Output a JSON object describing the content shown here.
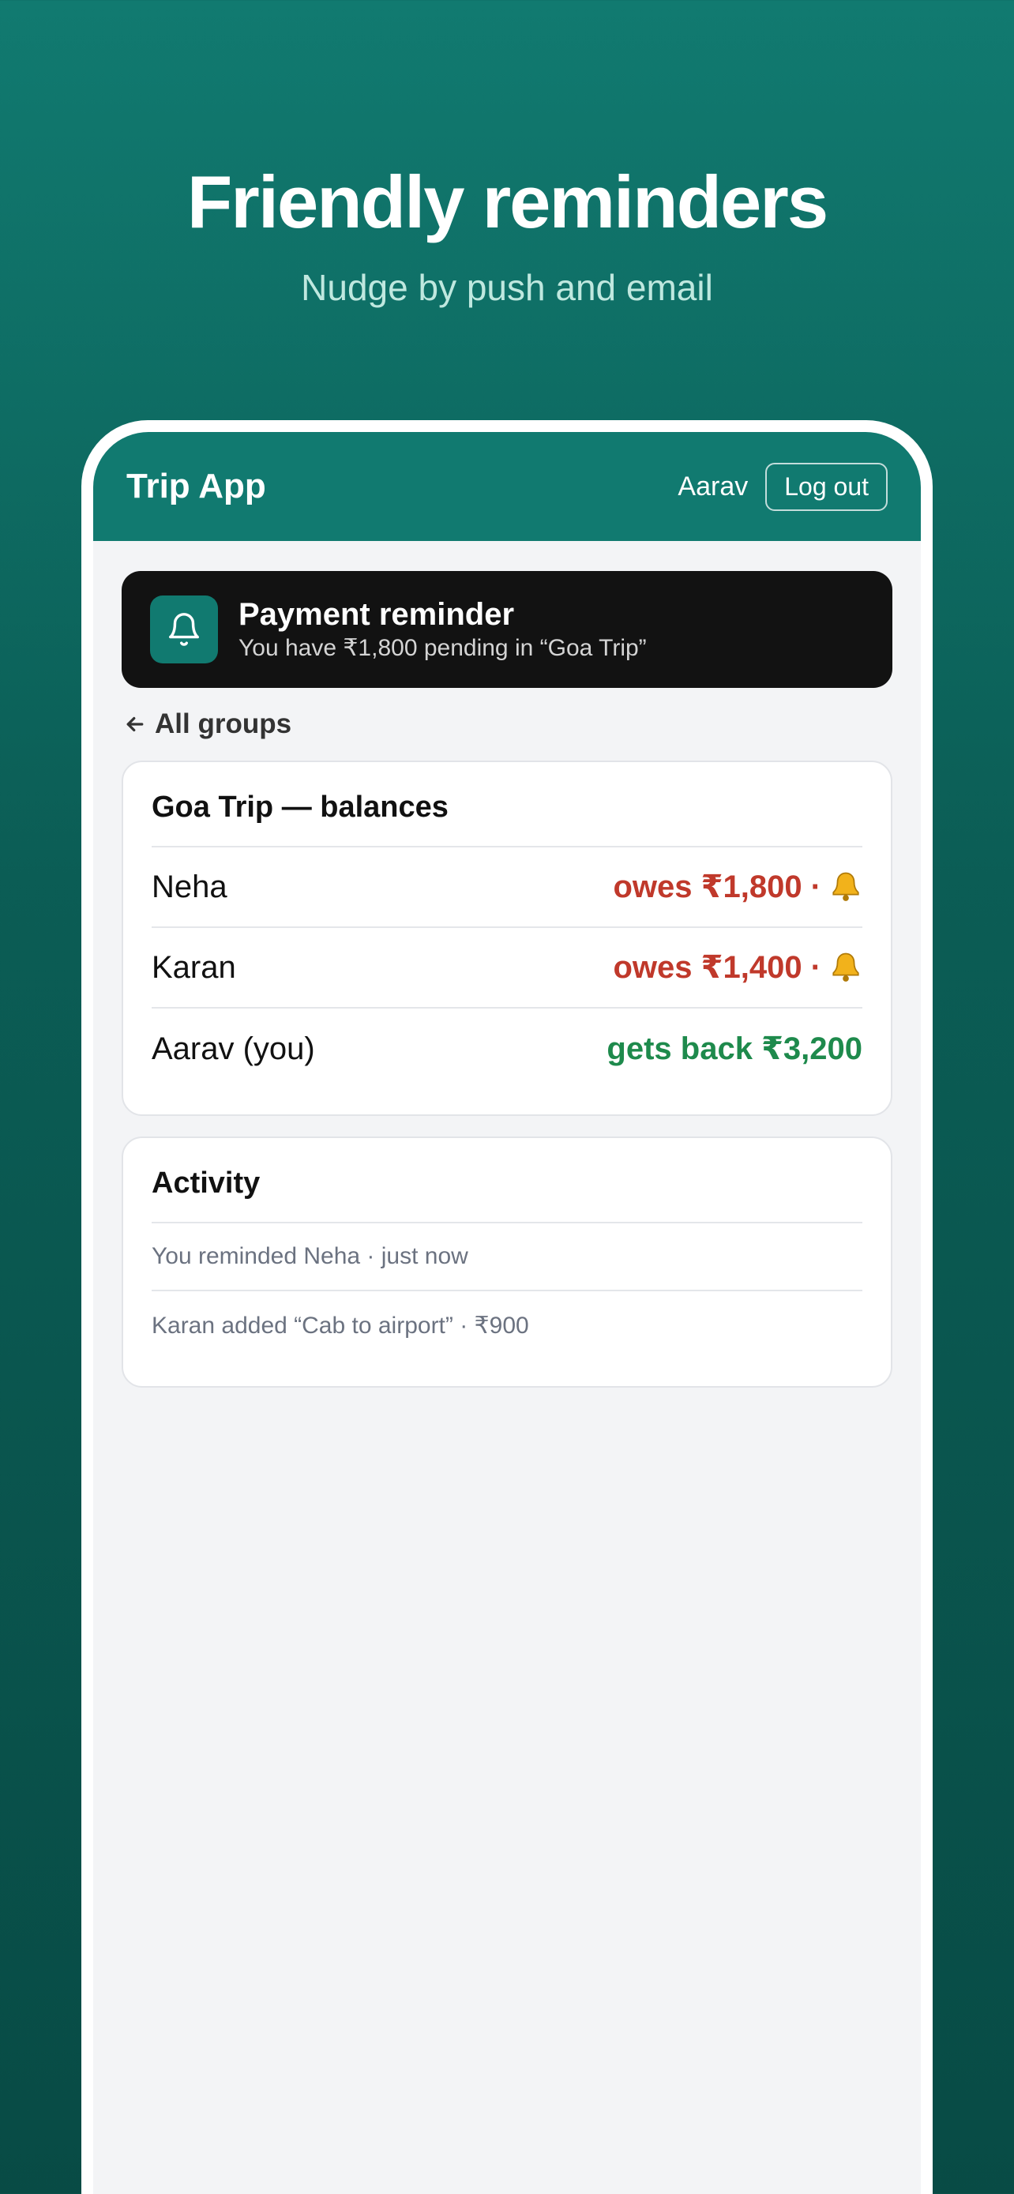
{
  "hero": {
    "title": "Friendly reminders",
    "subtitle": "Nudge by push and email"
  },
  "appbar": {
    "title": "Trip App",
    "user": "Aarav",
    "logout_label": "Log out"
  },
  "notification": {
    "icon": "bell-icon",
    "title": "Payment reminder",
    "text": "You have ₹1,800 pending in “Goa Trip”"
  },
  "nav": {
    "back_label": "All groups"
  },
  "balances": {
    "title": "Goa Trip — balances",
    "rows": [
      {
        "name": "Neha",
        "value": "owes ₹1,800 ·",
        "status": "owes",
        "remind_icon": "bell-icon"
      },
      {
        "name": "Karan",
        "value": "owes ₹1,400 ·",
        "status": "owes",
        "remind_icon": "bell-icon"
      },
      {
        "name": "Aarav (you)",
        "value": "gets back ₹3,200",
        "status": "gets"
      }
    ]
  },
  "activity": {
    "title": "Activity",
    "items": [
      "You reminded Neha · just now",
      "Karan added “Cab to airport” · ₹900"
    ]
  },
  "colors": {
    "brand": "#117a70",
    "owes": "#c0392b",
    "gets": "#1e8a4c",
    "toast_bg": "#121212"
  }
}
